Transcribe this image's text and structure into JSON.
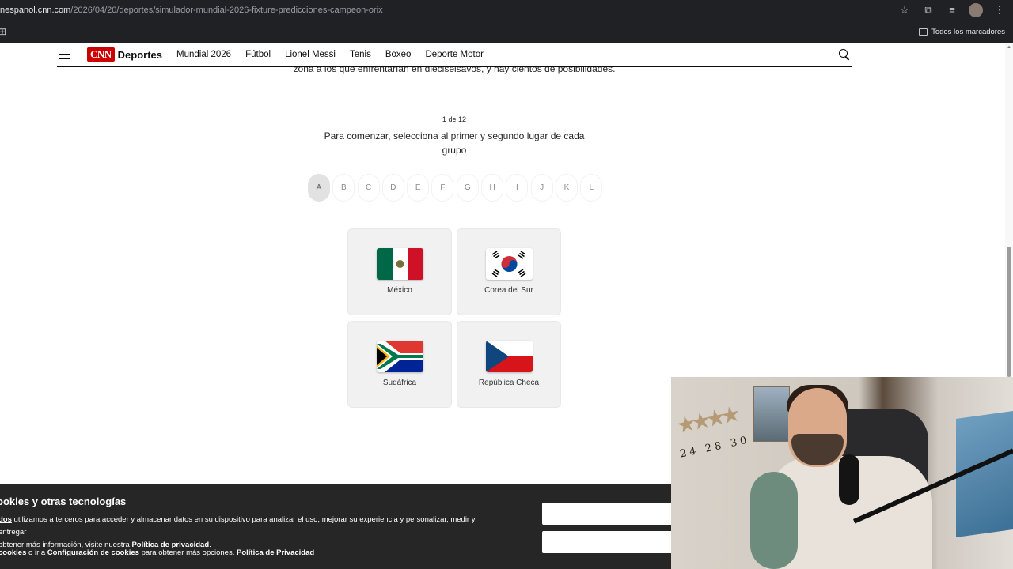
{
  "browser": {
    "url_host": "nespanol.cnn.com",
    "url_path": "/2026/04/20/deportes/simulador-mundial-2026-fixture-predicciones-campeon-orix",
    "bookmarks_all_label": "Todos los marcadores"
  },
  "site": {
    "logo_badge": "CNN",
    "section": "Deportes",
    "nav": [
      "Mundial 2026",
      "Fútbol",
      "Lionel Messi",
      "Tenis",
      "Boxeo",
      "Deporte Motor"
    ]
  },
  "article": {
    "cut_text": "zona a los que enfrentarían en dieciseisavos, y hay cientos de posibilidades."
  },
  "quiz": {
    "step": "1 de 12",
    "question": "Para comenzar, selecciona al primer y segundo lugar de cada grupo",
    "groups": [
      "A",
      "B",
      "C",
      "D",
      "E",
      "F",
      "G",
      "H",
      "I",
      "J",
      "K",
      "L"
    ],
    "active_group": "A",
    "teams": [
      {
        "name": "México",
        "flag": "mexico-flag"
      },
      {
        "name": "Corea del Sur",
        "flag": "south-korea-flag"
      },
      {
        "name": "Sudáfrica",
        "flag": "south-africa-flag"
      },
      {
        "name": "República Checa",
        "flag": "czech-republic-flag"
      }
    ]
  },
  "cookie_banner": {
    "title": "ookies y otras tecnologías",
    "body_lead": "dos",
    "body_text": " utilizamos a terceros para acceder y almacenar datos en su dispositivo para analizar el uso, mejorar su experiencia y personalizar, medir y entregar",
    "body_text2": " obtener más información, visite nuestra ",
    "privacy_link": "Política de privacidad",
    "line2_lead": "cookies",
    "line2_mid": " o ir a ",
    "config_link": "Configuración de cookies",
    "line2_tail": " para obtener más opciones. ",
    "privacy_link2": "Política de Privacidad"
  },
  "webcam": {
    "wall_numbers": "24 28 30 50"
  },
  "colors": {
    "cnn_red": "#cc0000",
    "chrome_dark": "#202124",
    "card_bg": "#f1f1f1",
    "cookie_bg": "#262626"
  }
}
